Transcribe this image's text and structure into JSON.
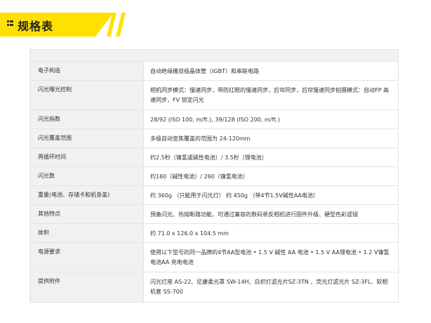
{
  "header": {
    "title": "规格表"
  },
  "colors": {
    "accent": "#ffe100",
    "label_bg": "#f1f1f1",
    "border": "#e4e4e4"
  },
  "specs": [
    {
      "label": "电子构造",
      "value": "自动绝缘栅双极晶体管（IGBT）和串联电路"
    },
    {
      "label": "闪光曝光控制",
      "value": "相机同步模式：慢速同步，带防红眼的慢速同步，后帘同步，后帘慢速同步拍摄模式：自动FP 高速同步，FV 锁定闪光"
    },
    {
      "label": "闪光指数",
      "value": "28/92 (ISO 100, m/ft.), 39/128 (ISO 200, m/ft.)"
    },
    {
      "label": "闪光覆盖范围",
      "value": "多级自动变焦覆盖的范围为 24-120mm"
    },
    {
      "label": "再循环时间",
      "value": "约2.5秒（镍氢或碱性电池）/ 3.5秒（锂电池）"
    },
    {
      "label": "闪光数",
      "value": "约160（碱性电池）/ 260（镍氢电池）"
    },
    {
      "label": "重量(电池、存储卡和机身盖)",
      "value": "约 360g （只能用于闪光灯） 约 450g （带4节1.5V碱性AA电池）"
    },
    {
      "label": "其他特点",
      "value": "预备闪光、热熔断路功能、可通过兼容的数码单反相机进行固件升级、硬型色彩滤镜"
    },
    {
      "label": "体积",
      "value": "约 71.0 x 126.0 x 104.5 mm"
    },
    {
      "label": "电源要求",
      "value": "使用以下型号的同一品牌的4节AA型电池 • 1.5 V 碱性 AA 电池 • 1.5 V AA锂电池 • 1.2 V镍氢电池AA 充电电池"
    },
    {
      "label": "提供附件",
      "value": "闪光灯座 AS-22、尼康柔光罩 SW-14H、白炽灯滤光片SZ-3TN 、荧光灯滤光片 SZ-3FL、软相机套 SS-700"
    }
  ]
}
